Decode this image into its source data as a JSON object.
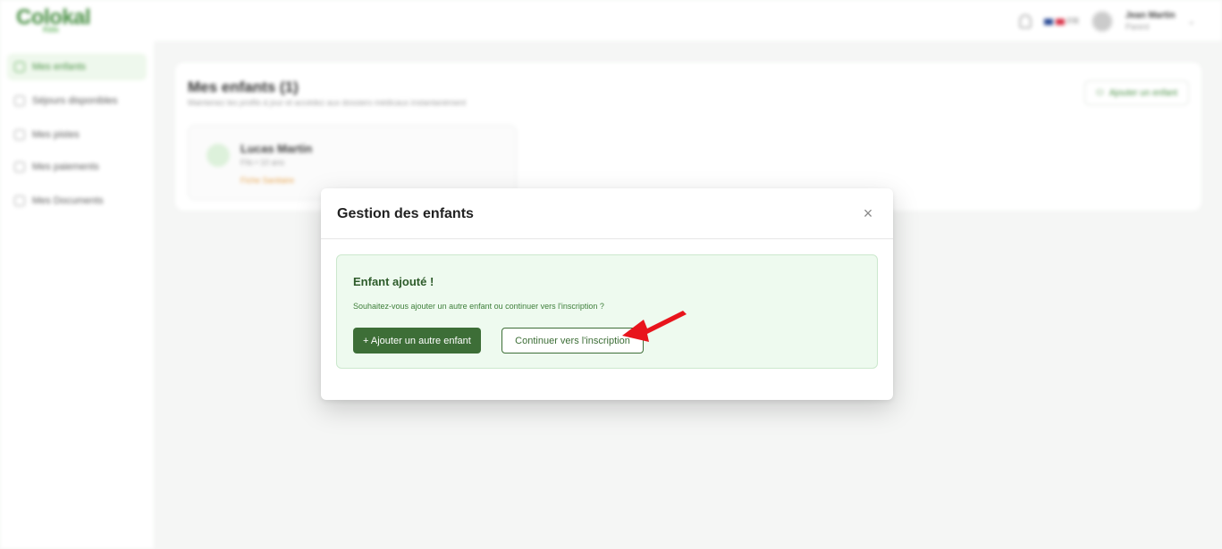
{
  "app": {
    "logo": "Colokal",
    "logo_sub": "Kids",
    "user_name": "Jean Martin",
    "user_role": "Parent",
    "lang": "FR"
  },
  "sidebar": {
    "items": [
      {
        "label": "Mes enfants"
      },
      {
        "label": "Séjours disponibles"
      },
      {
        "label": "Mes pistes"
      },
      {
        "label": "Mes paiements"
      },
      {
        "label": "Mes Documents"
      }
    ]
  },
  "main": {
    "title": "Mes enfants (1)",
    "subtitle": "Maintenez les profils à jour et accédez aux dossiers médicaux instantanément",
    "add_button": "Ajouter un enfant",
    "child": {
      "name": "Lucas Martin",
      "meta": "Fils • 10 ans",
      "tag": "Fiche Sanitaire"
    }
  },
  "modal": {
    "title": "Gestion des enfants",
    "close_symbol": "×",
    "success_title": "Enfant ajouté !",
    "success_text": "Souhaitez-vous ajouter un autre enfant ou continuer vers l'inscription ?",
    "add_another_label": "+ Ajouter un autre enfant",
    "continue_label": "Continuer vers l'inscription"
  },
  "colors": {
    "primary": "#3d6e37",
    "success_bg": "#eefaef",
    "annotation_arrow": "#e8141c"
  }
}
